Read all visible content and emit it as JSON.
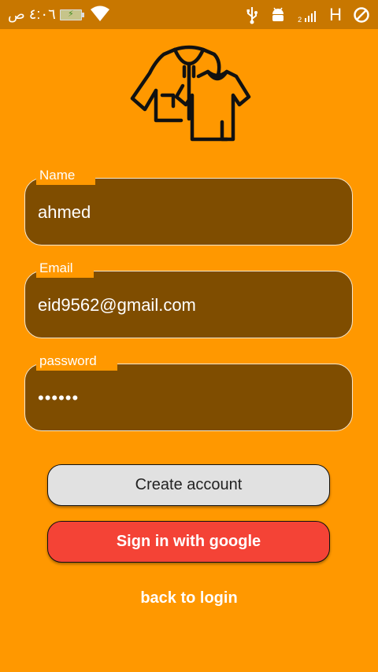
{
  "status_bar": {
    "time": "٤:٠٦ ص",
    "network_type": "H",
    "sim_slot": "2",
    "icons": [
      "battery-icon",
      "wifi-icon",
      "usb-icon",
      "android-debug-icon",
      "signal-icon",
      "do-not-disturb-icon"
    ]
  },
  "logo": {
    "icon": "clothes-logo-icon"
  },
  "form": {
    "name": {
      "label": "Name",
      "value": "ahmed"
    },
    "email": {
      "label": "Email",
      "value": "eid9562@gmail.com"
    },
    "password": {
      "label": "password",
      "value": "••••••"
    }
  },
  "buttons": {
    "create_account": "Create account",
    "google_sign_in": "Sign in with google",
    "back_to_login": "back to login"
  },
  "colors": {
    "background": "#FF9800",
    "status_bar": "#C87700",
    "field_fill": "#7F4D00",
    "create_button": "#E1E1E1",
    "google_button": "#F44336"
  }
}
